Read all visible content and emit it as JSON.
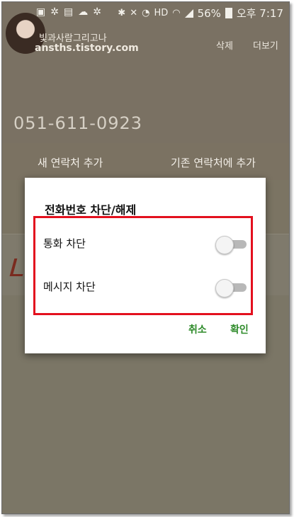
{
  "status_bar": {
    "battery_pct": "56%",
    "time_label": "오후 7:17",
    "left_icons": [
      "notification-icon",
      "photo-icon",
      "settings-icon",
      "gift-icon",
      "cloud-icon",
      "settings-icon"
    ],
    "right_icons": [
      "bluetooth-icon",
      "mute-icon",
      "alarm-icon",
      "hd-icon",
      "wifi-icon",
      "signal-icon",
      "battery-icon"
    ]
  },
  "watermark": {
    "title": "빛과사람그리고나",
    "url": "ansths.tistory.com"
  },
  "header": {
    "delete_label": "삭제",
    "more_label": "더보기",
    "phone_number": "051-611-0923"
  },
  "contact_actions": {
    "new_contact": "새 연락처 추가",
    "existing_contact": "기존 연락처에 추가"
  },
  "dialog": {
    "title": "전화번호 차단/해제",
    "options": [
      {
        "label": "통화 차단",
        "enabled": false
      },
      {
        "label": "메시지 차단",
        "enabled": false
      }
    ],
    "cancel_label": "취소",
    "ok_label": "확인",
    "accent_color": "#2e8b2a",
    "highlight_color": "#e3101e"
  }
}
